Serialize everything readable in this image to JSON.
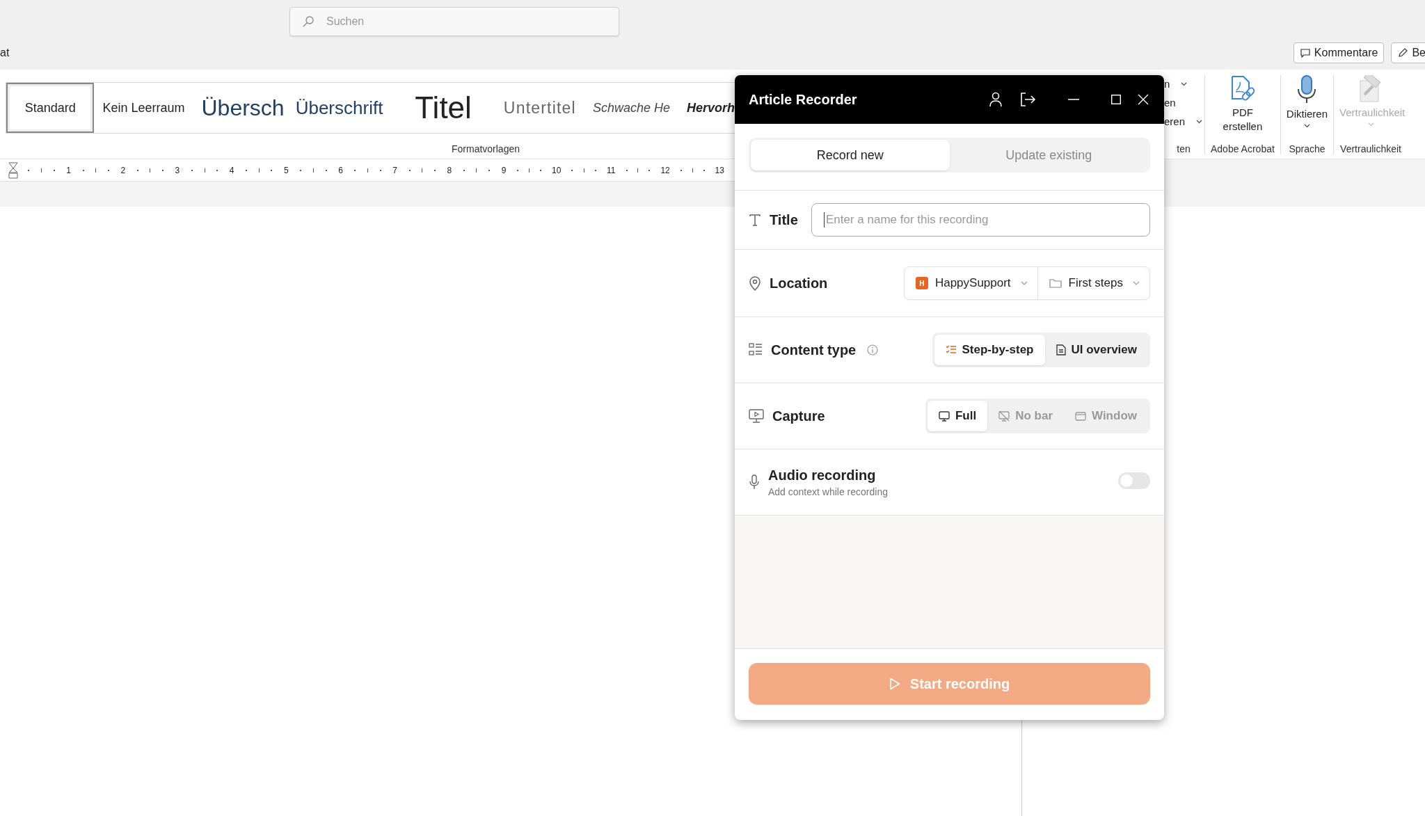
{
  "app_bar": {
    "search": {
      "placeholder": "Suchen"
    },
    "tab_fragment": "at",
    "buttons": [
      {
        "kind": "comment",
        "label": "Kommentare"
      },
      {
        "kind": "edit",
        "label": "Be"
      }
    ]
  },
  "ribbon": {
    "styles": [
      {
        "kind": "normal",
        "label": "Standard",
        "selected": true
      },
      {
        "kind": "nospace",
        "label": "Kein Leerraum",
        "selected": false
      },
      {
        "kind": "heading1",
        "label": "Übersch",
        "selected": false
      },
      {
        "kind": "heading2",
        "label": "Überschrift",
        "selected": false
      },
      {
        "kind": "title",
        "label": "Titel",
        "selected": false
      },
      {
        "kind": "subtitle",
        "label": "Untertitel",
        "selected": false
      },
      {
        "kind": "subtle",
        "label": "Schwache He",
        "selected": false
      },
      {
        "kind": "emphasis",
        "label": "Hervorh",
        "selected": false
      }
    ],
    "styles_group": "Formatvorlagen",
    "partial_items": [
      {
        "label": "n",
        "dropdown": true
      },
      {
        "label": "en",
        "dropdown": false
      },
      {
        "label": "eren",
        "dropdown": true
      }
    ],
    "partial_group": "ten",
    "groups": [
      {
        "name": "Adobe Acrobat",
        "command": {
          "kind": "pdf",
          "label": "PDF erstellen",
          "dropdown": false,
          "disabled": false
        }
      },
      {
        "name": "Sprache",
        "command": {
          "kind": "mic",
          "label": "Diktieren",
          "dropdown": true,
          "disabled": false
        }
      },
      {
        "name": "Vertraulichkeit",
        "command": {
          "kind": "shield",
          "label": "Vertraulichkeit",
          "dropdown": true,
          "disabled": true
        }
      }
    ]
  },
  "ruler": {
    "numbers": [
      "1",
      "2",
      "3",
      "4",
      "5",
      "6",
      "7",
      "8",
      "9",
      "10",
      "11",
      "12",
      "13"
    ]
  },
  "recorder": {
    "title": "Article Recorder",
    "mode_tabs": [
      {
        "label": "Record new",
        "selected": true
      },
      {
        "label": "Update existing",
        "selected": false
      }
    ],
    "rows": [
      {
        "kind": "title",
        "label": "Title",
        "placeholder": "Enter a name for this recording"
      },
      {
        "kind": "location",
        "label": "Location",
        "workspace": {
          "badge": "H",
          "name": "HappySupport"
        },
        "folder": "First steps"
      },
      {
        "kind": "contenttype",
        "label": "Content type",
        "info": true,
        "options": [
          {
            "label": "Step-by-step",
            "selected": true
          },
          {
            "label": "UI overview",
            "selected": false
          }
        ]
      },
      {
        "kind": "capture",
        "label": "Capture",
        "options": [
          {
            "label": "Full",
            "selected": true
          },
          {
            "label": "No bar",
            "selected": false
          },
          {
            "label": "Window",
            "selected": false
          }
        ]
      },
      {
        "kind": "audio",
        "label": "Audio recording",
        "hint": "Add context while recording",
        "on": false
      }
    ],
    "start_button": {
      "label": "Start recording",
      "disabled": true
    }
  }
}
